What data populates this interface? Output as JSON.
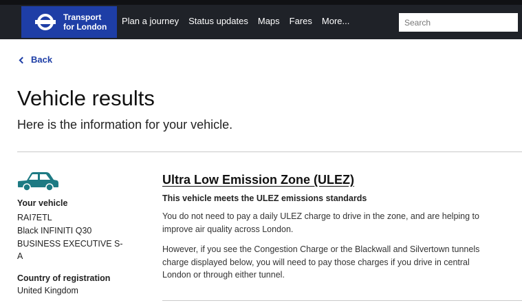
{
  "header": {
    "brand_line1": "Transport",
    "brand_line2": "for London",
    "nav": [
      "Plan a journey",
      "Status updates",
      "Maps",
      "Fares",
      "More..."
    ],
    "search_placeholder": "Search"
  },
  "back_label": "Back",
  "page_title": "Vehicle results",
  "intro": "Here is the information for your vehicle.",
  "vehicle": {
    "label": "Your vehicle",
    "registration": "RAI7ETL",
    "description": "Black INFINITI Q30 BUSINESS EXECUTIVE S-A",
    "country_label": "Country of registration",
    "country": "United Kingdom"
  },
  "ulez": {
    "title": "Ultra Low Emission Zone (ULEZ)",
    "status": "This vehicle meets the ULEZ emissions standards",
    "para1": "You do not need to pay a daily ULEZ charge to drive in the zone, and are helping to improve air quality across London.",
    "para2": "However, if you see the Congestion Charge or the Blackwall and Silvertown tunnels charge displayed below, you will need to pay those charges if you drive in central London or through either tunnel."
  },
  "colors": {
    "brand_blue": "#1e3ea6",
    "header_dark": "#1f2228",
    "car_teal": "#1d7a83"
  }
}
